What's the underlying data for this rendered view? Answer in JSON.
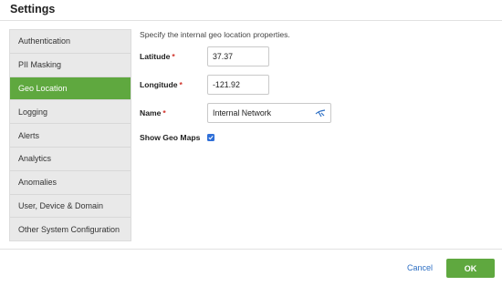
{
  "header": {
    "title": "Settings"
  },
  "sidebar": {
    "items": [
      {
        "label": "Authentication"
      },
      {
        "label": "PII Masking"
      },
      {
        "label": "Geo Location"
      },
      {
        "label": "Logging"
      },
      {
        "label": "Alerts"
      },
      {
        "label": "Analytics"
      },
      {
        "label": "Anomalies"
      },
      {
        "label": "User, Device & Domain"
      },
      {
        "label": "Other System Configuration"
      }
    ],
    "active_index": 2,
    "active_color": "#5fa83f"
  },
  "main": {
    "description": "Specify the internal geo location properties.",
    "required_marker": "*",
    "latitude": {
      "label": "Latitude",
      "value": "37.37"
    },
    "longitude": {
      "label": "Longitude",
      "value": "-121.92"
    },
    "name": {
      "label": "Name",
      "value": "Internal Network",
      "icon": "globe-icon"
    },
    "show_geo_maps": {
      "label": "Show Geo Maps",
      "checked": true
    }
  },
  "footer": {
    "cancel_label": "Cancel",
    "ok_label": "OK"
  },
  "colors": {
    "accent": "#5fa83f",
    "link": "#2d6fc4",
    "required": "#d0342c",
    "checkbox": "#2f6fd8"
  }
}
